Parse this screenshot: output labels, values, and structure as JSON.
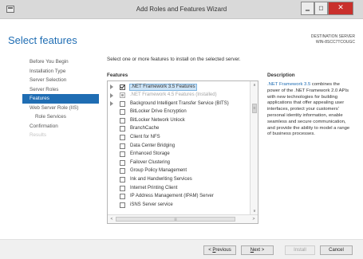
{
  "window": {
    "title": "Add Roles and Features Wizard",
    "minimize": "▁",
    "maximize": "□",
    "close": "✕"
  },
  "header": {
    "title": "Select features",
    "destination_label": "DESTINATION SERVER",
    "destination_server": "WIN-8SCC7TCOUGC"
  },
  "nav": {
    "items": [
      {
        "label": "Before You Begin",
        "state": "normal"
      },
      {
        "label": "Installation Type",
        "state": "normal"
      },
      {
        "label": "Server Selection",
        "state": "normal"
      },
      {
        "label": "Server Roles",
        "state": "normal"
      },
      {
        "label": "Features",
        "state": "active"
      },
      {
        "label": "Web Server Role (IIS)",
        "state": "normal"
      },
      {
        "label": "Role Services",
        "state": "sub"
      },
      {
        "label": "Confirmation",
        "state": "normal"
      },
      {
        "label": "Results",
        "state": "disabled"
      }
    ]
  },
  "main": {
    "instruction": "Select one or more features to install on the selected server.",
    "features_header": "Features",
    "features": [
      {
        "label": ".NET Framework 3.5 Features",
        "expandable": true,
        "checkbox": "checked",
        "selected": true,
        "dim": false
      },
      {
        "label": ".NET Framework 4.5 Features (Installed)",
        "expandable": true,
        "checkbox": "partial",
        "selected": false,
        "dim": true
      },
      {
        "label": "Background Intelligent Transfer Service (BITS)",
        "expandable": true,
        "checkbox": "unchecked",
        "selected": false,
        "dim": false
      },
      {
        "label": "BitLocker Drive Encryption",
        "expandable": false,
        "checkbox": "unchecked",
        "selected": false,
        "dim": false
      },
      {
        "label": "BitLocker Network Unlock",
        "expandable": false,
        "checkbox": "unchecked",
        "selected": false,
        "dim": false
      },
      {
        "label": "BranchCache",
        "expandable": false,
        "checkbox": "unchecked",
        "selected": false,
        "dim": false
      },
      {
        "label": "Client for NFS",
        "expandable": false,
        "checkbox": "unchecked",
        "selected": false,
        "dim": false
      },
      {
        "label": "Data Center Bridging",
        "expandable": false,
        "checkbox": "unchecked",
        "selected": false,
        "dim": false
      },
      {
        "label": "Enhanced Storage",
        "expandable": false,
        "checkbox": "unchecked",
        "selected": false,
        "dim": false
      },
      {
        "label": "Failover Clustering",
        "expandable": false,
        "checkbox": "unchecked",
        "selected": false,
        "dim": false
      },
      {
        "label": "Group Policy Management",
        "expandable": false,
        "checkbox": "unchecked",
        "selected": false,
        "dim": false
      },
      {
        "label": "Ink and Handwriting Services",
        "expandable": false,
        "checkbox": "unchecked",
        "selected": false,
        "dim": false
      },
      {
        "label": "Internet Printing Client",
        "expandable": false,
        "checkbox": "unchecked",
        "selected": false,
        "dim": false
      },
      {
        "label": "IP Address Management (IPAM) Server",
        "expandable": false,
        "checkbox": "unchecked",
        "selected": false,
        "dim": false
      },
      {
        "label": "iSNS Server service",
        "expandable": false,
        "checkbox": "unchecked",
        "selected": false,
        "dim": false
      }
    ],
    "scroll_up": "∧",
    "scroll_down": "∨",
    "scroll_left": "<",
    "scroll_right": ">",
    "hscroll_grip": "|||"
  },
  "description": {
    "header": "Description",
    "highlight": ".NET Framework 3.5",
    "text": " combines the power of the .NET Framework 2.0 APIs with new technologies for building applications that offer appealing user interfaces, protect your customers' personal identity information, enable seamless and secure communication, and provide the ability to model a range of business processes."
  },
  "footer": {
    "previous_key": "P",
    "previous_rest": "revious",
    "previous_prefix": "< ",
    "next_key": "N",
    "next_rest": "ext >",
    "install": "Install",
    "cancel": "Cancel"
  },
  "colors": {
    "accent": "#1f6db3",
    "close_button": "#c9302c",
    "selection_bg": "#cde4f7"
  }
}
